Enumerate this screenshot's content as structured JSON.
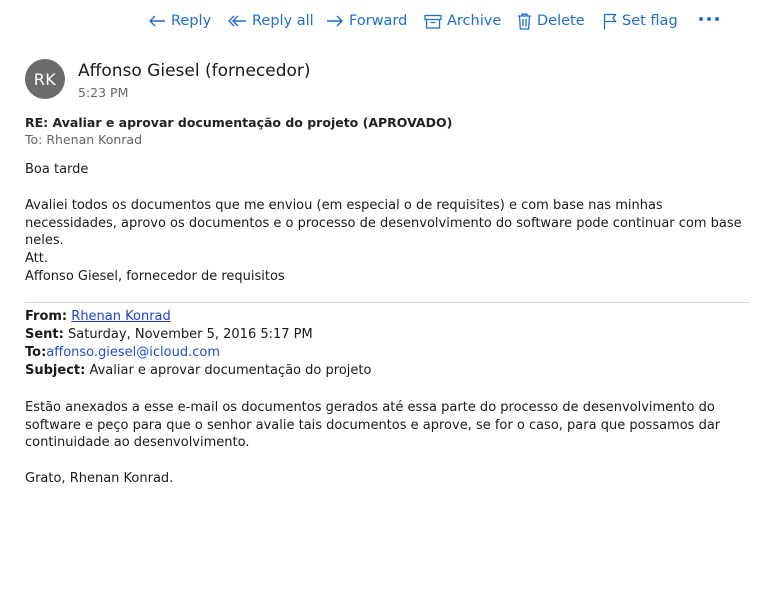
{
  "toolbar": {
    "reply": "Reply",
    "reply_all": "Reply all",
    "forward": "Forward",
    "archive": "Archive",
    "delete": "Delete",
    "set_flag": "Set flag",
    "accent_color": "#1e6fc9"
  },
  "message": {
    "avatar_initials": "RK",
    "sender": "Affonso Giesel (fornecedor)",
    "time": "5:23 PM",
    "subject": "RE: Avaliar e aprovar documentação do projeto (APROVADO)",
    "to_label": "To:",
    "to": "Rhenan Konrad",
    "body": {
      "greeting": "Boa tarde",
      "paragraph": "Avaliei todos os documentos que me enviou (em especial o de requisites) e com base nas minhas necessidades, aprovo os documentos e o processo de desenvolvimento do software pode continuar com base neles.",
      "signoff": "Att.",
      "signature": "Affonso Giesel, fornecedor de requisitos"
    }
  },
  "quoted": {
    "from_label": "From:",
    "from": "Rhenan Konrad",
    "sent_label": "Sent:",
    "sent": "Saturday, November 5, 2016 5:17 PM",
    "to_label": "To:",
    "to": "affonso.giesel@icloud.com",
    "subject_label": "Subject:",
    "subject": "Avaliar e aprovar documentação do projeto",
    "body": "Estão anexados a esse e-mail os documentos gerados até essa parte do processo de desenvolvimento do software e peço para que o senhor avalie tais documentos e aprove, se for o caso, para que possamos dar continuidade ao desenvolvimento.",
    "closing": "Grato, Rhenan Konrad."
  }
}
